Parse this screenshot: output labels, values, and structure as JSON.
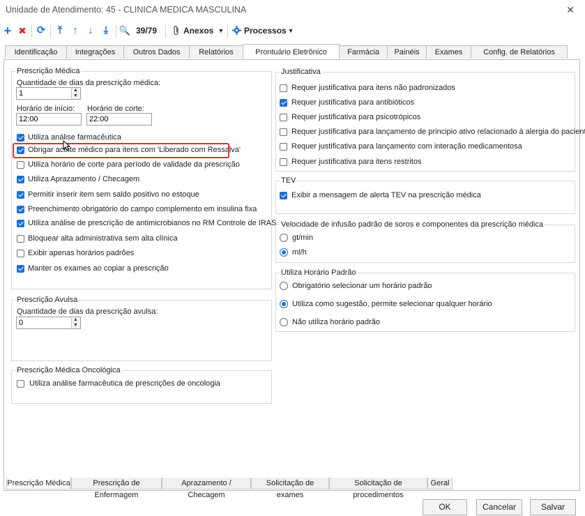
{
  "window": {
    "title": "Unidade de Atendimento: 45 - CLINICA MEDICA MASCULINA",
    "close": "✕"
  },
  "toolbar": {
    "add": "+",
    "delete": "✖",
    "refresh": "⟳",
    "first": "⤒",
    "up": "↑",
    "down": "↓",
    "last": "⤓",
    "search": "🔍",
    "record": "39/79",
    "attach_label": "Anexos",
    "process_label": "Processos",
    "dropdown": "▼"
  },
  "tabs": [
    {
      "label": "Identificação"
    },
    {
      "label": "Integrações"
    },
    {
      "label": "Outros Dados"
    },
    {
      "label": "Relatórios"
    },
    {
      "label": "Prontuário Eletrônico"
    },
    {
      "label": "Farmácia"
    },
    {
      "label": "Painéis"
    },
    {
      "label": "Exames"
    },
    {
      "label": "Config. de Relatórios"
    }
  ],
  "prescricao_medica": {
    "title": "Prescrição Médica",
    "qtd_dias_label": "Quantidade de dias da prescrição médica:",
    "qtd_dias_value": "1",
    "horario_inicio_label": "Horário de início:",
    "horario_inicio_value": "12:00",
    "horario_corte_label": "Horário de corte:",
    "horario_corte_value": "22:00",
    "options": [
      {
        "label": "Utiliza análise farmacêutica",
        "checked": true
      },
      {
        "label": "Obrigar aceite médico para itens com 'Liberado com Ressalva'",
        "checked": true
      },
      {
        "label": "Utiliza horário de corte para período de validade da prescrição",
        "checked": false
      },
      {
        "label": "Utiliza Aprazamento / Checagem",
        "checked": true
      },
      {
        "label": "Permitir inserir item sem saldo positivo no estoque",
        "checked": true
      },
      {
        "label": "Preenchimento obrigatório do campo complemento em insulina fixa",
        "checked": true
      },
      {
        "label": "Utiliza análise de prescrição de antimicrobianos no RM Controle de IRAS",
        "checked": true
      },
      {
        "label": "Bloquear alta administrativa sem alta clínica",
        "checked": false
      },
      {
        "label": "Exibir apenas horários padrões",
        "checked": false
      },
      {
        "label": "Manter os exames ao copiar a prescrição",
        "checked": true
      }
    ]
  },
  "prescricao_avulsa": {
    "title": "Prescrição Avulsa",
    "qtd_dias_label": "Quantidade de dias da prescrição avulsa:",
    "qtd_dias_value": "0"
  },
  "prescricao_oncologica": {
    "title": "Prescrição Médica Oncológica",
    "option_label": "Utiliza análise farmacêutica de prescrições de oncologia",
    "option_checked": false
  },
  "justificativa": {
    "title": "Justificativa",
    "options": [
      {
        "label": "Requer justificativa para itens não padronizados",
        "checked": false
      },
      {
        "label": "Requer justificativa para antibióticos",
        "checked": true
      },
      {
        "label": "Requer justificativa para psicotrópicos",
        "checked": false
      },
      {
        "label": "Requer justificativa para lançamento de principio ativo relacionado à alergia do paciente",
        "checked": false
      },
      {
        "label": "Requer justificativa para lançamento com interação medicamentosa",
        "checked": false
      },
      {
        "label": "Requer justificativa para itens restritos",
        "checked": false
      }
    ]
  },
  "tev": {
    "title": "TEV",
    "option_label": "Exibir a mensagem de alerta TEV na prescrição médica",
    "option_checked": true
  },
  "velocidade": {
    "title": "Velocidade de infusão padrão de soros e componentes da prescrição médica",
    "options": [
      {
        "label": "gt/min",
        "selected": false
      },
      {
        "label": "ml/h",
        "selected": true
      }
    ]
  },
  "horario_padrao": {
    "title": "Utiliza Horário Padrão",
    "options": [
      {
        "label": "Obrigatório selecionar um horário padrão",
        "selected": false
      },
      {
        "label": "Utiliza como sugestão, permite selecionar qualquer horário",
        "selected": true
      },
      {
        "label": "Não utiliza horário padrão",
        "selected": false
      }
    ]
  },
  "bottom_tabs": [
    {
      "label": "Prescrição Médica"
    },
    {
      "label": "Prescrição de Enfermagem"
    },
    {
      "label": "Aprazamento / Checagem"
    },
    {
      "label": "Solicitação de exames"
    },
    {
      "label": "Solicitação de procedimentos"
    },
    {
      "label": "Geral"
    }
  ],
  "buttons": {
    "ok": "OK",
    "cancel": "Cancelar",
    "save": "Salvar"
  },
  "colors": {
    "accent": "#1f6fd1",
    "highlight": "#e0312c",
    "delete": "#d32f2f",
    "add": "#1f6fd1"
  }
}
